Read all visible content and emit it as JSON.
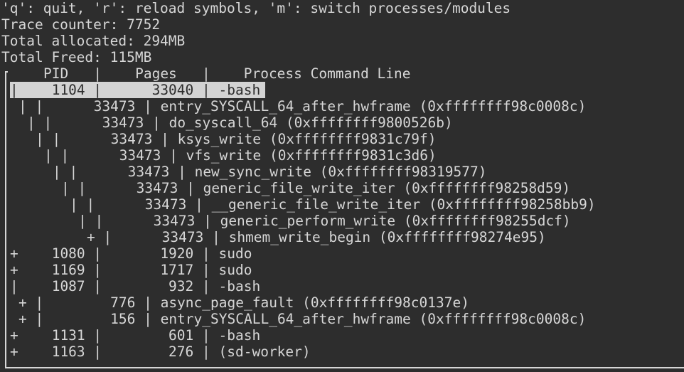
{
  "header": {
    "help_line": "'q': quit, 'r': reload symbols, 'm': switch processes/modules",
    "trace_counter": "Trace counter: 7752",
    "total_allocated": "Total allocated: 294MB",
    "total_freed": "Total Freed: 115MB"
  },
  "table": {
    "column_header": "    PID   |    Pages   |    Process Command Line",
    "rows": [
      "|    1104 |      33040 | -bash",
      "| |      33473 | entry_SYSCALL_64_after_hwframe (0xffffffff98c0008c)",
      "| |      33473 | do_syscall_64 (0xffffffff9800526b)",
      "| |      33473 | ksys_write (0xffffffff9831c79f)",
      "| |      33473 | vfs_write (0xffffffff9831c3d6)",
      "| |      33473 | new_sync_write (0xffffffff98319577)",
      "| |      33473 | generic_file_write_iter (0xffffffff98258d59)",
      "| |      33473 | __generic_file_write_iter (0xffffffff98258bb9)",
      "| |      33473 | generic_perform_write (0xffffffff98255dcf)",
      "+ |      33473 | shmem_write_begin (0xffffffff98274e95)",
      "+    1080 |       1920 | sudo",
      "+    1169 |       1717 | sudo",
      "|    1087 |        932 | -bash",
      "+ |        776 | async_page_fault (0xffffffff98c0137e)",
      "+ |        156 | entry_SYSCALL_64_after_hwframe (0xffffffff98c0008c)",
      "+    1131 |        601 | -bash",
      "+    1163 |        276 | (sd-worker)"
    ]
  }
}
